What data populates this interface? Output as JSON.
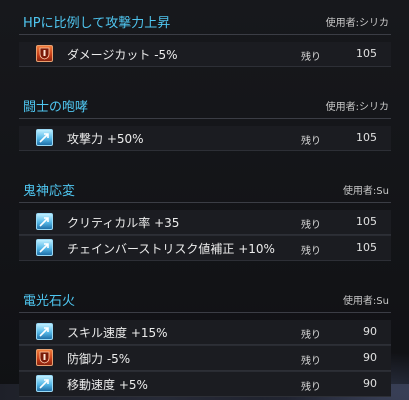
{
  "colors": {
    "title_accent": "#4fc6f0",
    "debuff_icon": "#d2471c",
    "buff_icon": "#57b9e8"
  },
  "remaining_label": "残り",
  "groups": [
    {
      "title": "HPに比例して攻撃力上昇",
      "user": "使用者:シリカ",
      "rows": [
        {
          "icon": "debuff-shield-icon",
          "name": "ダメージカット -5%",
          "remaining": "105"
        }
      ]
    },
    {
      "title": "闘士の咆哮",
      "user": "使用者:シリカ",
      "rows": [
        {
          "icon": "buff-arrow-icon",
          "name": "攻撃力 +50%",
          "remaining": "105"
        }
      ]
    },
    {
      "title": "鬼神応変",
      "user": "使用者:Su",
      "rows": [
        {
          "icon": "buff-arrow-icon",
          "name": "クリティカル率 +35",
          "remaining": "105"
        },
        {
          "icon": "buff-arrow-icon",
          "name": "チェインバーストリスク値補正 +10%",
          "remaining": "105"
        }
      ]
    },
    {
      "title": "電光石火",
      "user": "使用者:Su",
      "rows": [
        {
          "icon": "buff-arrow-icon",
          "name": "スキル速度 +15%",
          "remaining": "90"
        },
        {
          "icon": "debuff-shield-icon",
          "name": "防御力 -5%",
          "remaining": "90"
        },
        {
          "icon": "buff-arrow-icon",
          "name": "移動速度 +5%",
          "remaining": "90"
        }
      ]
    }
  ]
}
